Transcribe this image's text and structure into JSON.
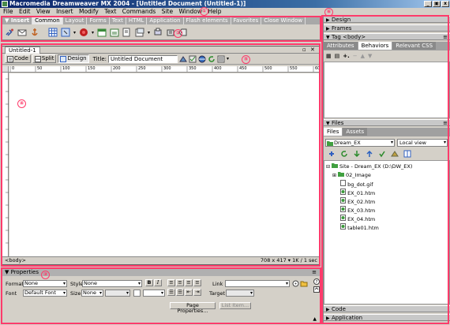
{
  "window": {
    "title": "Macromedia Dreamweaver MX 2004 - [Untitled Document (Untitled-1)]",
    "controls": [
      "_",
      "▣",
      "x"
    ]
  },
  "menu": [
    "File",
    "Edit",
    "View",
    "Insert",
    "Modify",
    "Text",
    "Commands",
    "Site",
    "Window",
    "Help"
  ],
  "insert_bar": {
    "label": "▼ Insert",
    "tabs": [
      "Common",
      "Layout",
      "Forms",
      "Text",
      "HTML",
      "Application",
      "Flash elements",
      "Favorites",
      "Close Window"
    ]
  },
  "document": {
    "tab": "Untitled-1",
    "views": [
      "Code",
      "Split",
      "Design"
    ],
    "title_label": "Title:",
    "title_value": "Untitled Document",
    "ruler_ticks": [
      "0",
      "50",
      "100",
      "150",
      "200",
      "250",
      "300",
      "350",
      "400",
      "450",
      "500",
      "550",
      "600"
    ],
    "tag_selector": "<body>",
    "status": "708 x 417 ▾ 1K / 1 sec"
  },
  "properties": {
    "title": "▼ Properties",
    "format_label": "Format",
    "format_value": "None",
    "style_label": "Style",
    "style_value": "None",
    "link_label": "Link",
    "font_label": "Font",
    "font_value": "Default Font",
    "size_label": "Size",
    "size_value": "None",
    "target_label": "Target",
    "page_props_button": "Page Properties...",
    "list_item_button": "List Item..."
  },
  "right_panels": {
    "design": "Design",
    "frames": "Frames",
    "tag": "Tag <body>",
    "tag_tabs": [
      "Attributes",
      "Behaviors",
      "Relevant CSS"
    ],
    "files_header": "Files",
    "files_tabs": [
      "Files",
      "Assets"
    ],
    "site_select": "Dream_EX",
    "view_select": "Local view",
    "tree_root": "Site - Dream_EX (D:\\DW_EX)",
    "tree_items": [
      "02_Image",
      "bg_dot.gif",
      "EX_01.htm",
      "EX_02.htm",
      "EX_03.htm",
      "EX_04.htm",
      "table01.htm"
    ],
    "code": "Code",
    "application": "Application"
  },
  "annotations": [
    "①",
    "②",
    "③",
    "④",
    "⑤",
    "⑥"
  ],
  "colors": {
    "annotation": "#ff3b6b",
    "titlebar_start": "#0a246a",
    "panel_bg": "#d4d0c8"
  }
}
